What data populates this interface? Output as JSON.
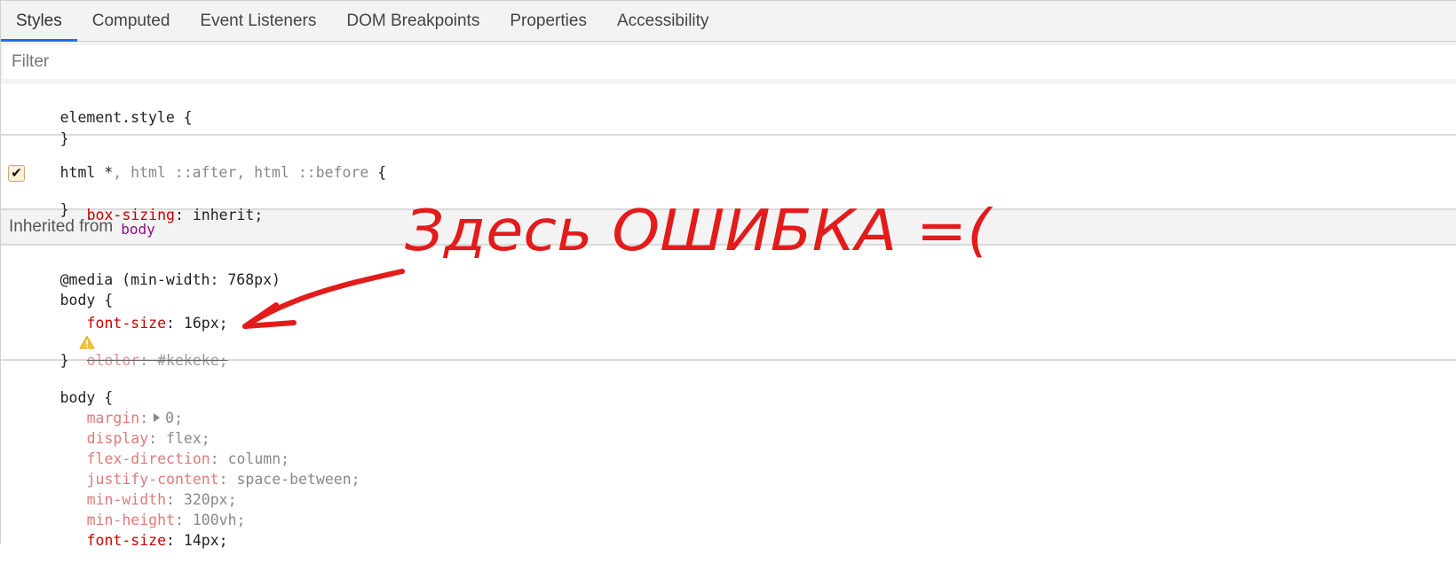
{
  "tabs": [
    {
      "label": "Styles",
      "active": true
    },
    {
      "label": "Computed",
      "active": false
    },
    {
      "label": "Event Listeners",
      "active": false
    },
    {
      "label": "DOM Breakpoints",
      "active": false
    },
    {
      "label": "Properties",
      "active": false
    },
    {
      "label": "Accessibility",
      "active": false
    }
  ],
  "filter": {
    "placeholder": "Filter",
    "value": ""
  },
  "rules": {
    "element_style": {
      "selector": "element.style",
      "open": " {",
      "close": "}"
    },
    "html_universal": {
      "selector_main": "html *",
      "selector_rest": ", html ::after, html ::before",
      "open": " {",
      "props": [
        {
          "name": "box-sizing",
          "value": "inherit",
          "checked": true
        }
      ],
      "close": "}"
    },
    "inherited": {
      "label": "Inherited from",
      "source": "body"
    },
    "media_body": {
      "media": "@media (min-width: 768px)",
      "selector": "body",
      "open": " {",
      "props": [
        {
          "name": "font-size",
          "value": "16px",
          "status": "active"
        },
        {
          "name": "ololor",
          "value": "#kekeke",
          "status": "invalid-struck"
        }
      ],
      "close": "}"
    },
    "body": {
      "selector": "body",
      "open": " {",
      "props": [
        {
          "name": "margin",
          "value": "0",
          "status": "inherited-inactive",
          "expandable": true
        },
        {
          "name": "display",
          "value": "flex",
          "status": "inherited-inactive"
        },
        {
          "name": "flex-direction",
          "value": "column",
          "status": "inherited-inactive"
        },
        {
          "name": "justify-content",
          "value": "space-between",
          "status": "inherited-inactive"
        },
        {
          "name": "min-width",
          "value": "320px",
          "status": "inherited-inactive"
        },
        {
          "name": "min-height",
          "value": "100vh",
          "status": "inherited-inactive"
        },
        {
          "name": "font-size",
          "value": "14px",
          "status": "active"
        }
      ]
    }
  },
  "annotation": {
    "text": "Здесь ОШИБКА =(",
    "color": "#e31b1b"
  },
  "colors": {
    "accent": "#1a73e8",
    "property_name": "#c80000",
    "inherited_source": "#881280",
    "warning": "#f2c230"
  }
}
